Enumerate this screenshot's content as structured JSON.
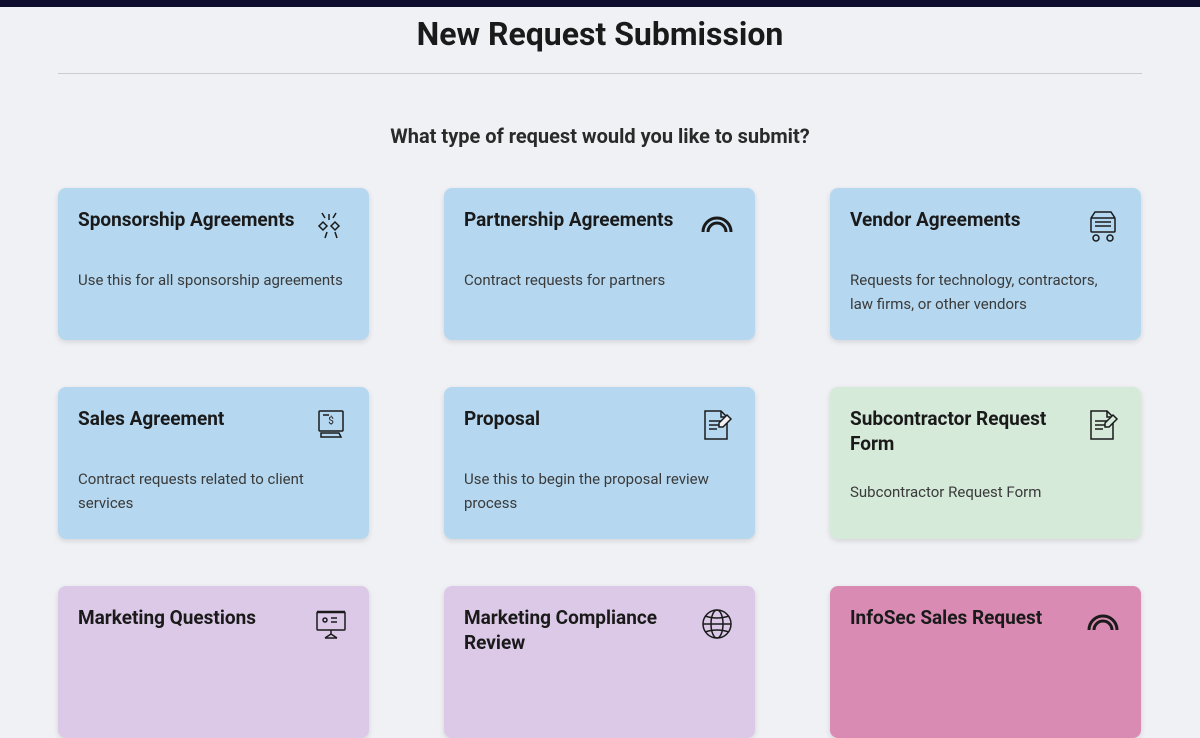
{
  "page": {
    "title": "New Request Submission",
    "subtitle": "What type of request would you like to submit?"
  },
  "cards": [
    {
      "title": "Sponsorship Agreements",
      "desc": "Use this for all sponsorship agreements",
      "icon": "hands-clap",
      "color": "blue"
    },
    {
      "title": "Partnership Agreements",
      "desc": "Contract requests for partners",
      "icon": "arc",
      "color": "blue"
    },
    {
      "title": "Vendor Agreements",
      "desc": "Requests for technology, contractors, law firms, or other vendors",
      "icon": "cart",
      "color": "blue"
    },
    {
      "title": "Sales Agreement",
      "desc": "Contract requests related to client services",
      "icon": "invoice",
      "color": "blue"
    },
    {
      "title": "Proposal",
      "desc": "Use this to begin the proposal review process",
      "icon": "doc-edit",
      "color": "blue"
    },
    {
      "title": "Subcontractor Request Form",
      "desc": "Subcontractor Request Form",
      "icon": "doc-edit",
      "color": "green"
    },
    {
      "title": "Marketing Questions",
      "desc": "",
      "icon": "presentation",
      "color": "purple"
    },
    {
      "title": "Marketing Compliance Review",
      "desc": "",
      "icon": "globe",
      "color": "purple"
    },
    {
      "title": "InfoSec Sales Request",
      "desc": "",
      "icon": "arc",
      "color": "pink"
    }
  ]
}
